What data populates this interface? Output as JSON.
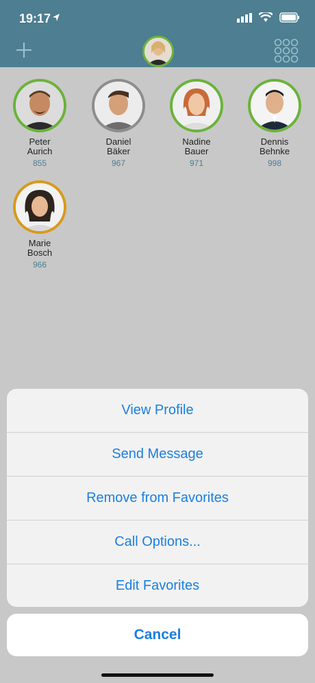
{
  "status_bar": {
    "time": "19:17"
  },
  "header": {
    "add_icon": "plus-icon",
    "user_avatar": "user-avatar",
    "dialpad_icon": "dialpad-icon"
  },
  "favorites": [
    {
      "first": "Peter",
      "last": "Aurich",
      "ext": "855",
      "status_color": "#6bb33a"
    },
    {
      "first": "Daniel",
      "last": "Bäker",
      "ext": "967",
      "status_color": "#8d8d8d"
    },
    {
      "first": "Nadine",
      "last": "Bauer",
      "ext": "971",
      "status_color": "#6bb33a"
    },
    {
      "first": "Dennis",
      "last": "Behnke",
      "ext": "998",
      "status_color": "#6bb33a"
    },
    {
      "first": "Marie",
      "last": "Bosch",
      "ext": "966",
      "status_color": "#d89a1b"
    }
  ],
  "action_sheet": {
    "items": [
      {
        "label": "View Profile"
      },
      {
        "label": "Send Message"
      },
      {
        "label": "Remove from Favorites"
      },
      {
        "label": "Call Options..."
      },
      {
        "label": "Edit Favorites"
      }
    ],
    "cancel_label": "Cancel"
  },
  "colors": {
    "header_bg": "#4d7e91",
    "accent": "#1b7fe0",
    "online": "#6bb33a",
    "away": "#d89a1b",
    "offline": "#8d8d8d"
  }
}
